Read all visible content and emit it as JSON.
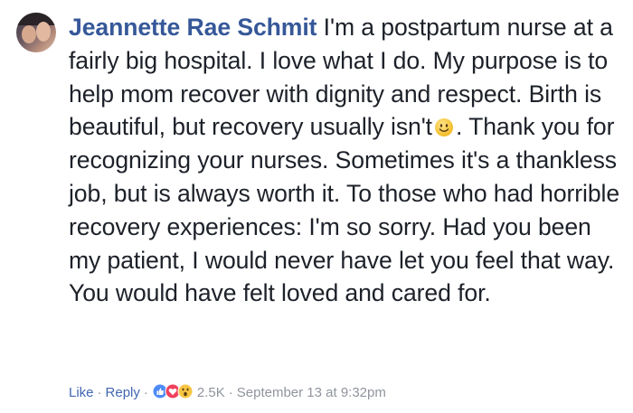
{
  "comment": {
    "author": "Jeannette Rae Schmit",
    "text_before_emoji": " I'm a postpartum nurse at a fairly big hospital. I love what I do. My purpose is to help mom recover with dignity and respect. Birth is beautiful, but recovery usually isn't",
    "emoji": "smiley-emoji",
    "text_after_emoji": ". Thank you for recognizing your nurses. Sometimes it's a thankless job, but is always worth it. To those who had horrible recovery experiences: I'm so sorry. Had you been my patient, I would never have let you feel that way. You would have felt loved and cared for."
  },
  "footer": {
    "like_label": "Like",
    "reply_label": "Reply",
    "separator": "·",
    "reaction_icons": [
      "like-reaction-icon",
      "love-reaction-icon",
      "wow-reaction-icon"
    ],
    "reaction_count": "2.5K",
    "timestamp": "September 13 at 9:32pm"
  },
  "colors": {
    "author": "#365899",
    "text": "#1d2129",
    "link": "#4267b2",
    "meta": "#90949c"
  }
}
